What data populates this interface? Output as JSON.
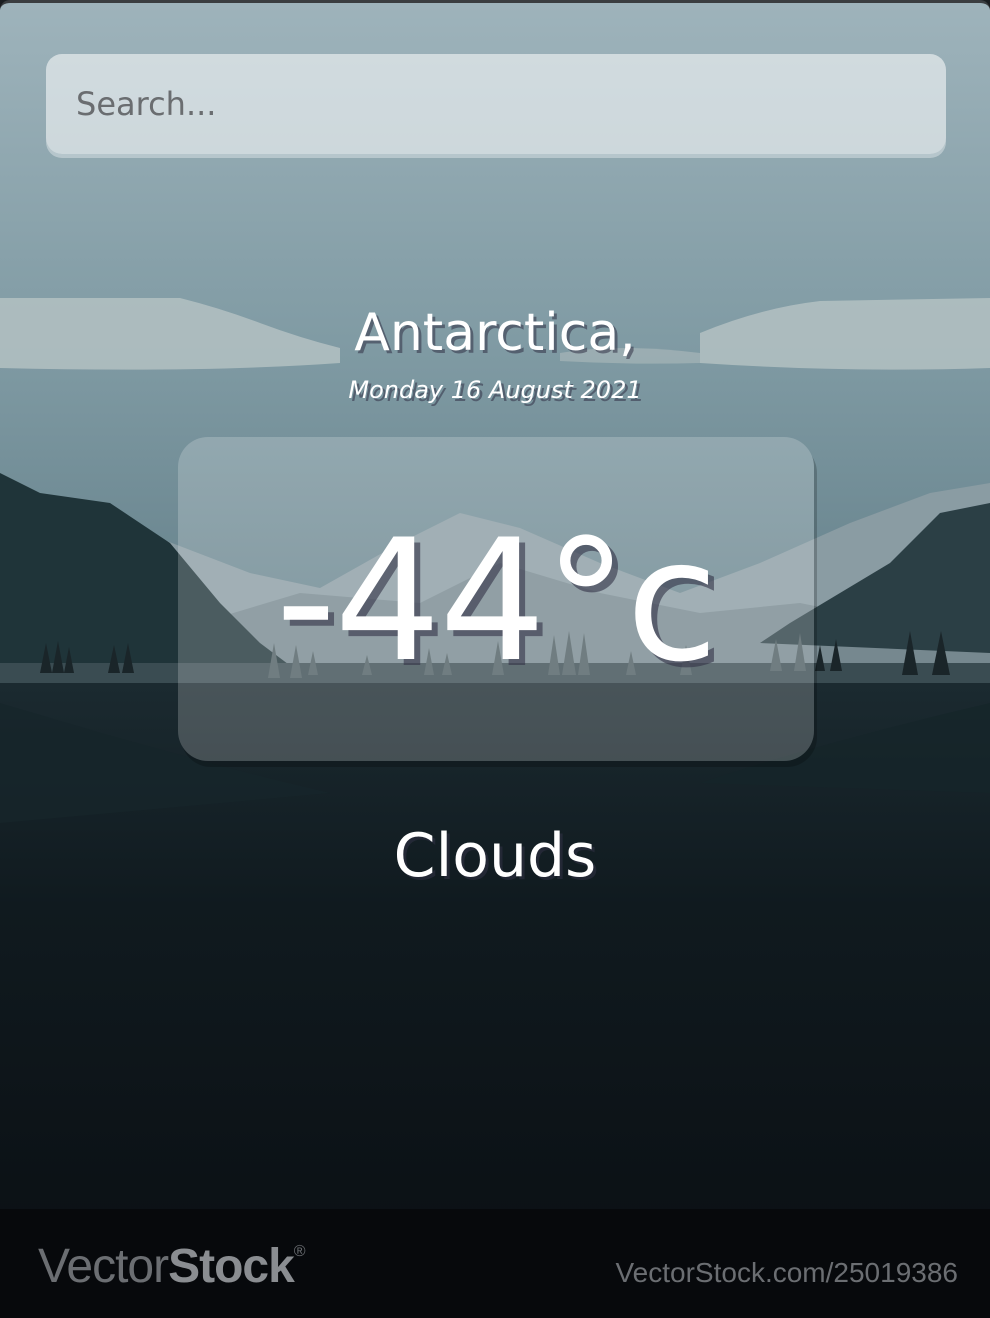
{
  "search": {
    "placeholder": "Search..."
  },
  "location": {
    "name": "Antarctica,",
    "date": "Monday 16 August 2021"
  },
  "weather": {
    "temperature": "-44°c",
    "condition": "Clouds"
  },
  "watermark": {
    "logo_light": "Vector",
    "logo_bold": "Stock",
    "logo_mark": "®",
    "url": "VectorStock.com/25019386"
  },
  "colors": {
    "sky_top": "#9db1b9",
    "mountain_near": "#1c3036",
    "lake_dark": "#0b1014",
    "text": "#ffffff"
  }
}
